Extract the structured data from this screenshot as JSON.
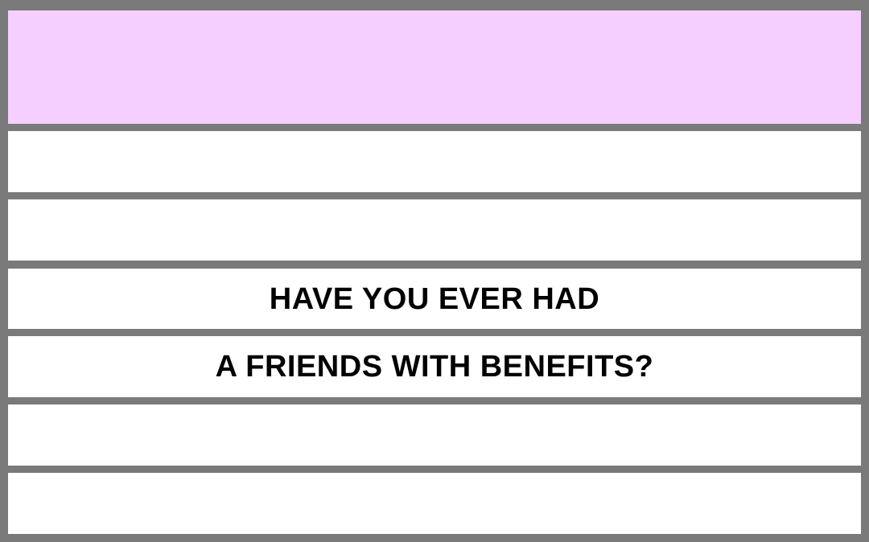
{
  "card": {
    "colors": {
      "frame": "#7a7a7a",
      "header_band": "#f4cfff",
      "band": "#ffffff",
      "text": "#000000"
    },
    "lines": [
      "",
      "",
      "",
      "HAVE YOU EVER HAD",
      "A FRIENDS WITH BENEFITS?",
      "",
      ""
    ]
  }
}
